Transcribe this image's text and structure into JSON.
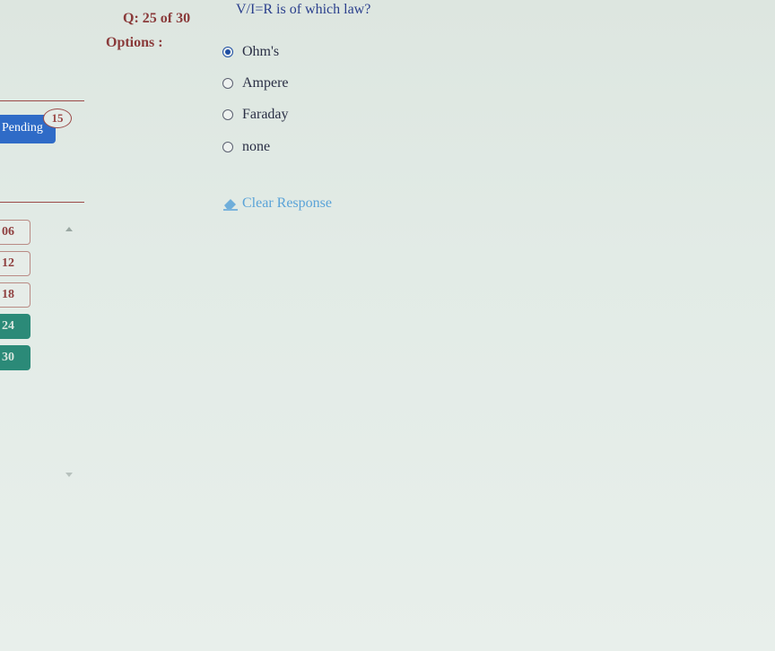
{
  "header": {
    "question_counter": "Q: 25 of 30",
    "question_text": "V/I=R is of which law?"
  },
  "options": {
    "label": "Options :",
    "items": [
      {
        "label": "Ohm's",
        "selected": true
      },
      {
        "label": "Ampere",
        "selected": false
      },
      {
        "label": "Faraday",
        "selected": false
      },
      {
        "label": "none",
        "selected": false
      }
    ],
    "clear_label": "Clear Response"
  },
  "sidebar": {
    "pending_label": "Pending",
    "pending_count": "15",
    "pages": [
      {
        "label": "06",
        "answered": false
      },
      {
        "label": "12",
        "answered": false
      },
      {
        "label": "18",
        "answered": false
      },
      {
        "label": "24",
        "answered": true
      },
      {
        "label": "30",
        "answered": true
      }
    ]
  },
  "colors": {
    "accent_blue": "#2f6bc7",
    "answered_teal": "#2b8a78",
    "label_maroon": "#8a3a3a",
    "link_blue": "#5aa3d8"
  }
}
